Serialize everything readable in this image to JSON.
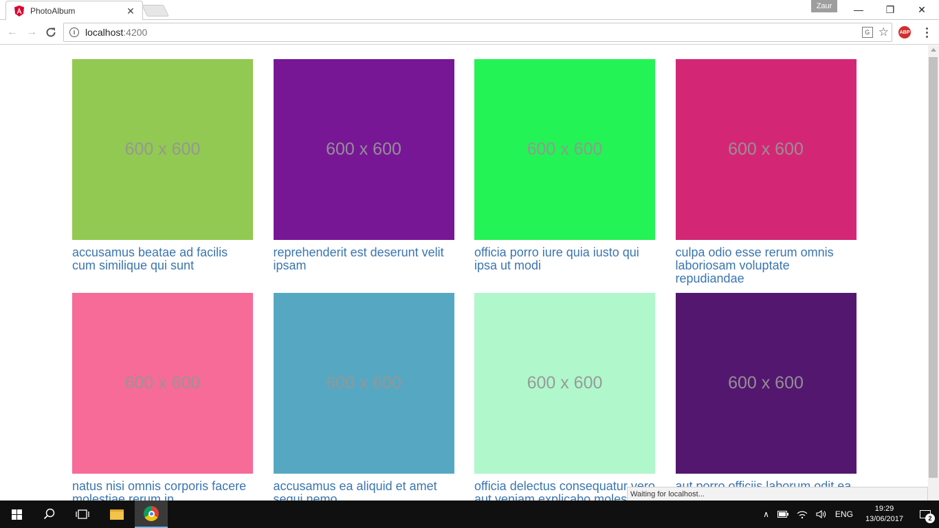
{
  "browser": {
    "tab_title": "PhotoAlbum",
    "profile_name": "Zaur",
    "url_host": "localhost",
    "url_port": ":4200",
    "status_text": "Waiting for localhost...",
    "abp_label": "ABP"
  },
  "window_controls": {
    "minimize": "—",
    "restore": "❐",
    "close": "✕"
  },
  "photos": [
    {
      "title": "accusamus beatae ad facilis cum similique qui sunt",
      "placeholder": "600 x 600",
      "color": "#92c952"
    },
    {
      "title": "reprehenderit est deserunt velit ipsam",
      "placeholder": "600 x 600",
      "color": "#771796"
    },
    {
      "title": "officia porro iure quia iusto qui ipsa ut modi",
      "placeholder": "600 x 600",
      "color": "#24f355"
    },
    {
      "title": "culpa odio esse rerum omnis laboriosam voluptate repudiandae",
      "placeholder": "600 x 600",
      "color": "#d32776"
    },
    {
      "title": "natus nisi omnis corporis facere molestiae rerum in",
      "placeholder": "600 x 600",
      "color": "#f66b97"
    },
    {
      "title": "accusamus ea aliquid et amet sequi nemo",
      "placeholder": "600 x 600",
      "color": "#56a8c2"
    },
    {
      "title": "officia delectus consequatur vero aut veniam explicabo molestias",
      "placeholder": "600 x 600",
      "color": "#b0f7cc"
    },
    {
      "title": "aut porro officiis laborum odit ea laudantium corporis",
      "placeholder": "600 x 600",
      "color": "#54176f"
    }
  ],
  "taskbar": {
    "language": "ENG",
    "time": "19:29",
    "date": "13/06/2017",
    "notification_count": "2"
  }
}
